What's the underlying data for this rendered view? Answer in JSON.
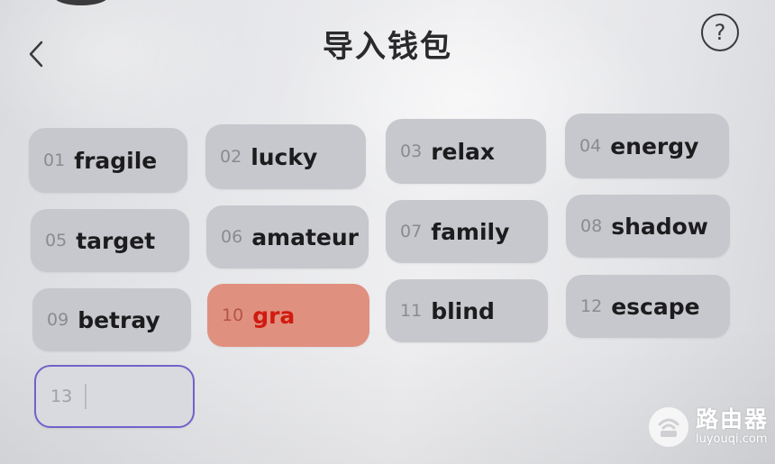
{
  "header": {
    "title": "导入钱包",
    "help_label": "?"
  },
  "words": [
    {
      "num": "01",
      "word": "fragile"
    },
    {
      "num": "02",
      "word": "lucky"
    },
    {
      "num": "03",
      "word": "relax"
    },
    {
      "num": "04",
      "word": "energy"
    },
    {
      "num": "05",
      "word": "target"
    },
    {
      "num": "06",
      "word": "amateur"
    },
    {
      "num": "07",
      "word": "family"
    },
    {
      "num": "08",
      "word": "shadow"
    },
    {
      "num": "09",
      "word": "betray"
    },
    {
      "num": "10",
      "word": "gra",
      "state": "invalid"
    },
    {
      "num": "11",
      "word": "blind"
    },
    {
      "num": "12",
      "word": "escape"
    },
    {
      "num": "13",
      "word": "",
      "state": "active"
    }
  ],
  "watermark": {
    "name": "路由器",
    "url": "luyouqi.com"
  },
  "colors": {
    "chip_bg": "#c7c8cd",
    "chip_error_bg": "#e0907f",
    "chip_error_text": "#d11a10",
    "active_border": "#7063c8"
  }
}
